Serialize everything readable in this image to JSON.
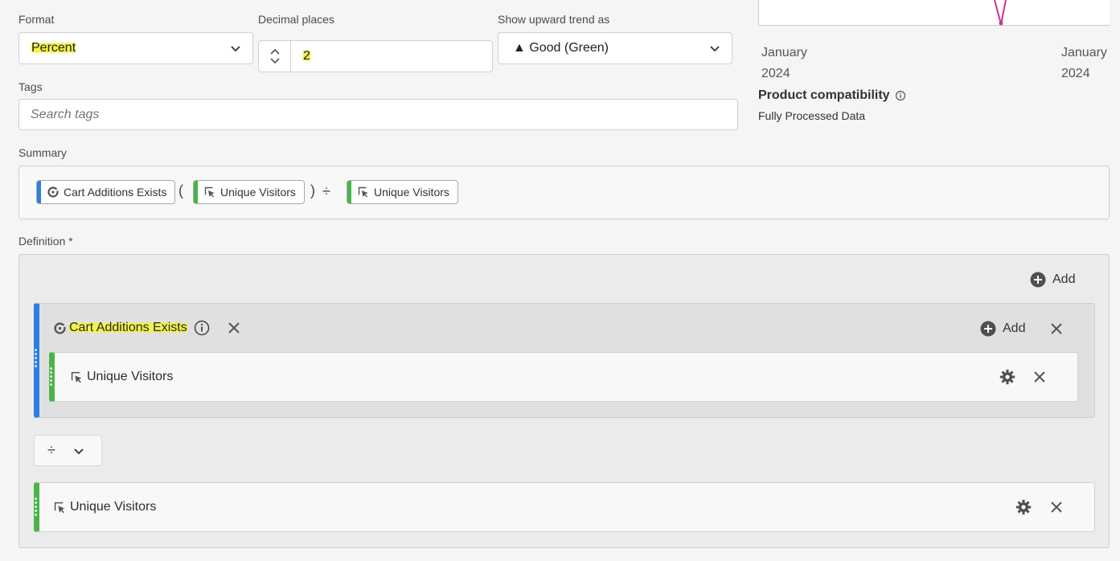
{
  "format": {
    "label": "Format",
    "value": "Percent"
  },
  "decimal": {
    "label": "Decimal places",
    "value": "2"
  },
  "trend": {
    "label": "Show upward trend as",
    "value": "▲ Good (Green)"
  },
  "tags": {
    "label": "Tags",
    "placeholder": "Search tags"
  },
  "chart_axis": {
    "left_month": "January",
    "left_year": "2024",
    "right_month": "January",
    "right_year": "2024"
  },
  "product": {
    "title": "Product compatibility",
    "value": "Fully Processed Data"
  },
  "summary": {
    "label": "Summary",
    "chip1": "Cart Additions Exists",
    "open_paren": "(",
    "chip2": "Unique Visitors",
    "close_paren": ")",
    "divide": "÷",
    "chip3": "Unique Visitors"
  },
  "definition": {
    "label": "Definition",
    "required": "*",
    "add_label": "Add",
    "segment": {
      "title": "Cart Additions Exists",
      "add_label": "Add",
      "metric": "Unique Visitors"
    },
    "operator": "÷",
    "metric2": "Unique Visitors"
  },
  "colors": {
    "segment_blue": "#2d7ee2",
    "metric_green": "#4ab34a",
    "highlight": "#f2f24a",
    "chart_line": "#c8358e"
  }
}
